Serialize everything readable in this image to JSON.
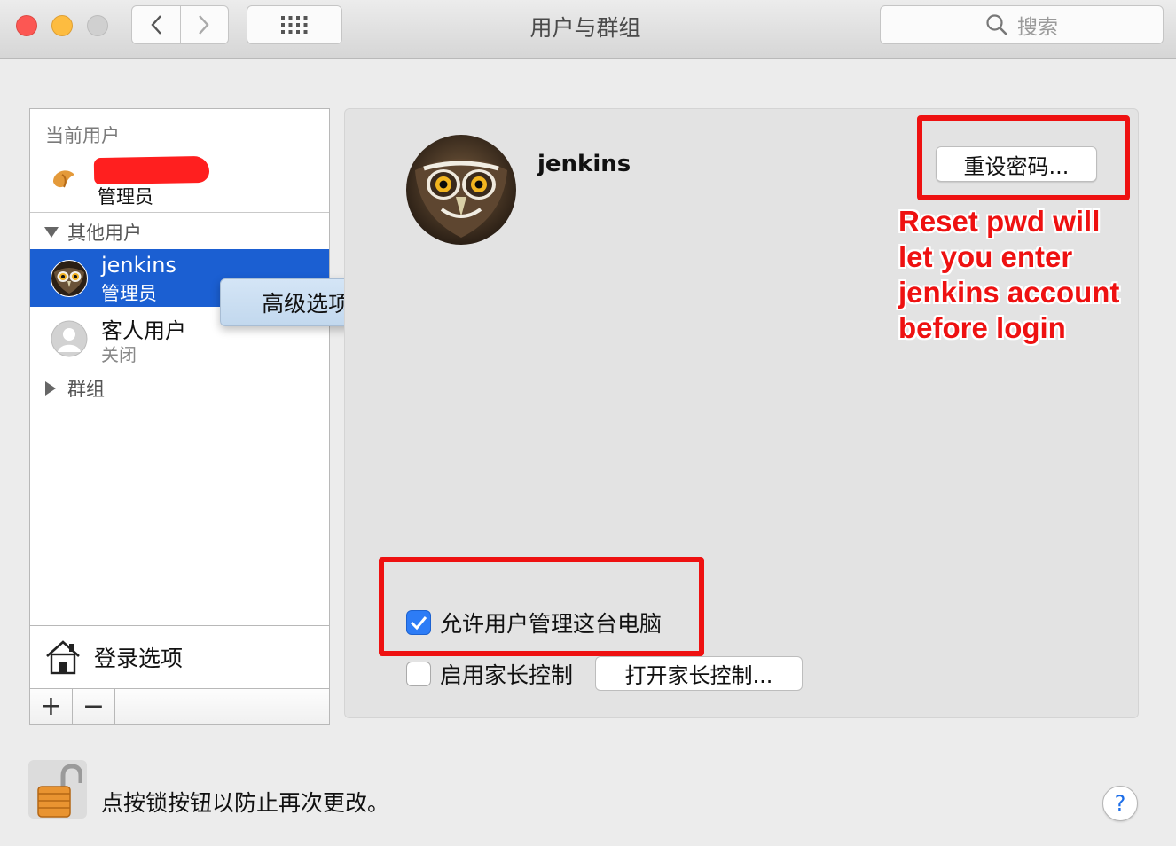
{
  "window": {
    "title": "用户与群组"
  },
  "toolbar": {
    "back_icon": "chevron-left-icon",
    "forward_icon": "chevron-right-icon",
    "grid_icon": "grid-icon",
    "search_placeholder": "搜索"
  },
  "sidebar": {
    "current_user_label": "当前用户",
    "current_user_role": "管理员",
    "other_users_label": "其他用户",
    "users": [
      {
        "name": "jenkins",
        "role": "管理员",
        "selected": true
      },
      {
        "name": "客人用户",
        "status": "关闭",
        "selected": false
      }
    ],
    "groups_label": "群组",
    "login_options_label": "登录选项",
    "add_label": "+",
    "remove_label": "−"
  },
  "context_menu": {
    "item": "高级选项..."
  },
  "detail": {
    "user_name": "jenkins",
    "reset_password_label": "重设密码...",
    "allow_admin_label": "允许用户管理这台电脑",
    "allow_admin_checked": true,
    "parental_controls_label": "启用家长控制",
    "parental_controls_checked": false,
    "open_parental_controls_label": "打开家长控制..."
  },
  "annotation": {
    "lines": [
      "Reset pwd will",
      "let you enter",
      "jenkins account",
      "before login"
    ],
    "color": "#ee1111"
  },
  "footer": {
    "lock_text": "点按锁按钮以防止再次更改。",
    "help_label": "?"
  },
  "colors": {
    "selection": "#1b5fd2",
    "checkbox_on": "#2d7cf6",
    "annotation_red": "#ee1111"
  }
}
